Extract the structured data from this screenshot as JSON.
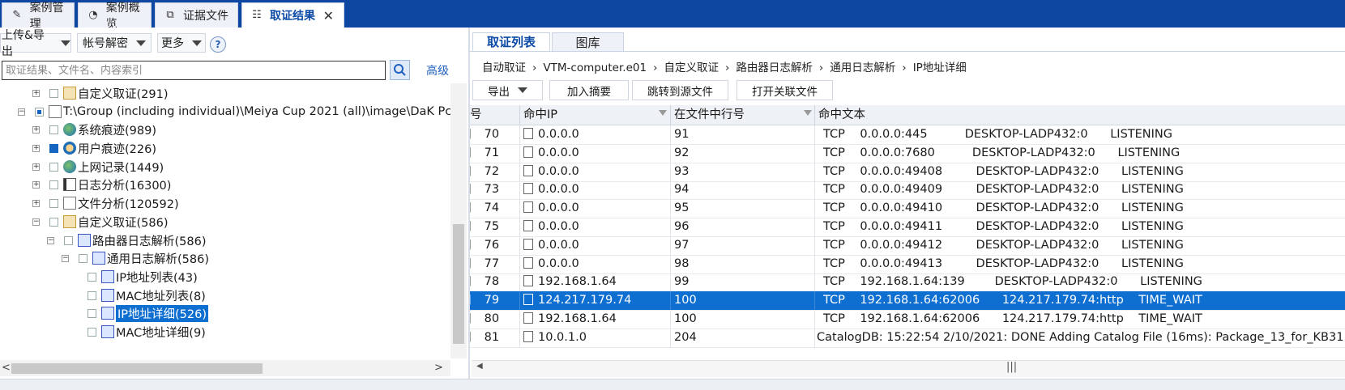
{
  "tabs": [
    {
      "label": "案例管理",
      "icon": "edit-icon",
      "active": false
    },
    {
      "label": "案例概览",
      "icon": "overview-icon",
      "active": false
    },
    {
      "label": "证据文件",
      "icon": "evidence-icon",
      "active": false
    },
    {
      "label": "取证结果",
      "icon": "result-icon",
      "active": true
    }
  ],
  "tab_close": "✕",
  "toolbar": {
    "upload_export": "上传&导出",
    "account_decrypt": "帐号解密",
    "more": "更多",
    "help": "?",
    "search_placeholder": "取证结果、文件名、内容索引",
    "advanced": "高级"
  },
  "tree": [
    {
      "label": "自定义取证(291)",
      "icon": "folder-icon",
      "expander": "+",
      "check": "none"
    },
    {
      "label": "T:\\Group (including individual)\\Meiya Cup 2021 (all)\\image\\DaK Pc",
      "icon": "document-icon",
      "expander": "−",
      "check": "partial"
    },
    {
      "label": "系统痕迹(989)",
      "icon": "globe-icon",
      "expander": "+",
      "check": "none"
    },
    {
      "label": "用户痕迹(226)",
      "icon": "user-icon",
      "expander": "+",
      "check": "checked"
    },
    {
      "label": "上网记录(1449)",
      "icon": "globe-icon",
      "expander": "+",
      "check": "none"
    },
    {
      "label": "日志分析(16300)",
      "icon": "log-icon",
      "expander": "+",
      "check": "none"
    },
    {
      "label": "文件分析(120592)",
      "icon": "document-icon",
      "expander": "+",
      "check": "none"
    },
    {
      "label": "自定义取证(586)",
      "icon": "folder-icon",
      "expander": "−",
      "check": "none"
    },
    {
      "label": "路由器日志解析(586)",
      "icon": "pen-icon",
      "expander": "−",
      "check": "none"
    },
    {
      "label": "通用日志解析(586)",
      "icon": "pen-icon",
      "expander": "−",
      "check": "none"
    },
    {
      "label": "IP地址列表(43)",
      "icon": "pen-icon",
      "expander": "",
      "check": "none"
    },
    {
      "label": "MAC地址列表(8)",
      "icon": "pen-icon",
      "expander": "",
      "check": "none"
    },
    {
      "label": "IP地址详细(526)",
      "icon": "pen-icon",
      "expander": "",
      "check": "none",
      "selected": true
    },
    {
      "label": "MAC地址详细(9)",
      "icon": "pen-icon",
      "expander": "",
      "check": "none"
    }
  ],
  "right": {
    "subtabs": [
      "取证列表",
      "图库"
    ],
    "breadcrumb": [
      "自动取证",
      "VTM-computer.e01",
      "自定义取证",
      "路由器日志解析",
      "通用日志解析",
      "IP地址详细"
    ],
    "breadcrumb_sep": "›",
    "actions": {
      "export": "导出",
      "add_summary": "加入摘要",
      "goto_source": "跳转到源文件",
      "open_related": "打开关联文件"
    }
  },
  "grid": {
    "columns": [
      "号",
      "命中IP",
      "在文件中行号",
      "命中文本"
    ],
    "rows": [
      {
        "no": "70",
        "ip": "0.0.0.0",
        "line": "91",
        "text": "TCP    0.0.0.0:445          DESKTOP-LADP432:0      LISTENING"
      },
      {
        "no": "71",
        "ip": "0.0.0.0",
        "line": "92",
        "text": "TCP    0.0.0.0:7680          DESKTOP-LADP432:0      LISTENING"
      },
      {
        "no": "72",
        "ip": "0.0.0.0",
        "line": "93",
        "text": "TCP    0.0.0.0:49408         DESKTOP-LADP432:0      LISTENING"
      },
      {
        "no": "73",
        "ip": "0.0.0.0",
        "line": "94",
        "text": "TCP    0.0.0.0:49409         DESKTOP-LADP432:0      LISTENING"
      },
      {
        "no": "74",
        "ip": "0.0.0.0",
        "line": "95",
        "text": "TCP    0.0.0.0:49410         DESKTOP-LADP432:0      LISTENING"
      },
      {
        "no": "75",
        "ip": "0.0.0.0",
        "line": "96",
        "text": "TCP    0.0.0.0:49411         DESKTOP-LADP432:0      LISTENING"
      },
      {
        "no": "76",
        "ip": "0.0.0.0",
        "line": "97",
        "text": "TCP    0.0.0.0:49412         DESKTOP-LADP432:0      LISTENING"
      },
      {
        "no": "77",
        "ip": "0.0.0.0",
        "line": "98",
        "text": "TCP    0.0.0.0:49413         DESKTOP-LADP432:0      LISTENING"
      },
      {
        "no": "78",
        "ip": "192.168.1.64",
        "line": "99",
        "text": "TCP    192.168.1.64:139        DESKTOP-LADP432:0      LISTENING"
      },
      {
        "no": "79",
        "ip": "124.217.179.74",
        "line": "100",
        "text": "TCP    192.168.1.64:62006      124.217.179.74:http    TIME_WAIT",
        "selected": true
      },
      {
        "no": "80",
        "ip": "192.168.1.64",
        "line": "100",
        "text": "TCP    192.168.1.64:62006      124.217.179.74:http    TIME_WAIT"
      },
      {
        "no": "81",
        "ip": "10.0.1.0",
        "line": "204",
        "text": "CatalogDB: 15:22:54 2/10/2021: DONE Adding Catalog File (16ms): Package_13_for_KB31"
      }
    ]
  },
  "colors": {
    "brand_bar": "#0d47a1",
    "selection": "#0e6fd1",
    "link": "#1f5fbf"
  }
}
